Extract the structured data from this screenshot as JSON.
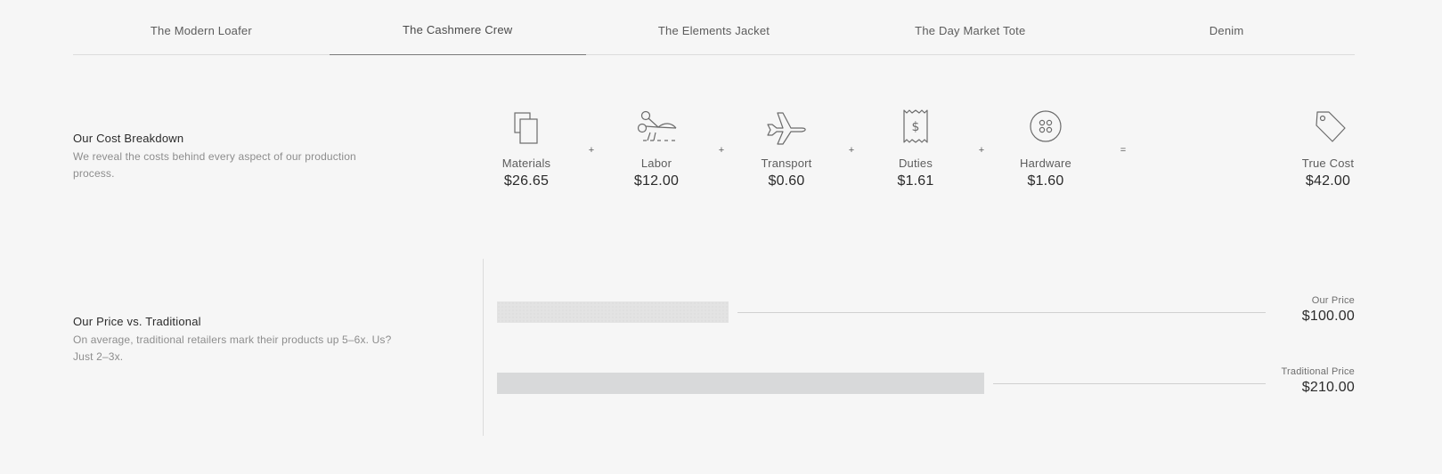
{
  "tabs": [
    {
      "label": "The Modern Loafer",
      "active": false
    },
    {
      "label": "The Cashmere Crew",
      "active": true
    },
    {
      "label": "The Elements Jacket",
      "active": false
    },
    {
      "label": "The Day Market Tote",
      "active": false
    },
    {
      "label": "Denim",
      "active": false
    }
  ],
  "cost_section": {
    "title": "Our Cost Breakdown",
    "description": "We reveal the costs behind every aspect of our production process.",
    "items": [
      {
        "label": "Materials",
        "value": "$26.65",
        "icon": "fabric-swatch-icon"
      },
      {
        "label": "Labor",
        "value": "$12.00",
        "icon": "scissors-icon"
      },
      {
        "label": "Transport",
        "value": "$0.60",
        "icon": "airplane-icon"
      },
      {
        "label": "Duties",
        "value": "$1.61",
        "icon": "receipt-icon"
      },
      {
        "label": "Hardware",
        "value": "$1.60",
        "icon": "button-icon"
      }
    ],
    "operators": [
      "+",
      "+",
      "+",
      "+",
      "="
    ],
    "total": {
      "label": "True Cost",
      "value": "$42.00",
      "icon": "price-tag-icon"
    }
  },
  "price_section": {
    "title": "Our Price vs. Traditional",
    "description": "On average, traditional retailers mark their products up 5–6x. Us? Just 2–3x.",
    "our_price": {
      "label": "Our Price",
      "value": "$100.00",
      "amount": 100
    },
    "traditional_price": {
      "label": "Traditional Price",
      "value": "$210.00",
      "amount": 210
    }
  },
  "colors": {
    "background": "#f6f6f6",
    "bar": "#d8d9da",
    "text": "#2b2b2b",
    "muted": "#8d8d8d"
  }
}
